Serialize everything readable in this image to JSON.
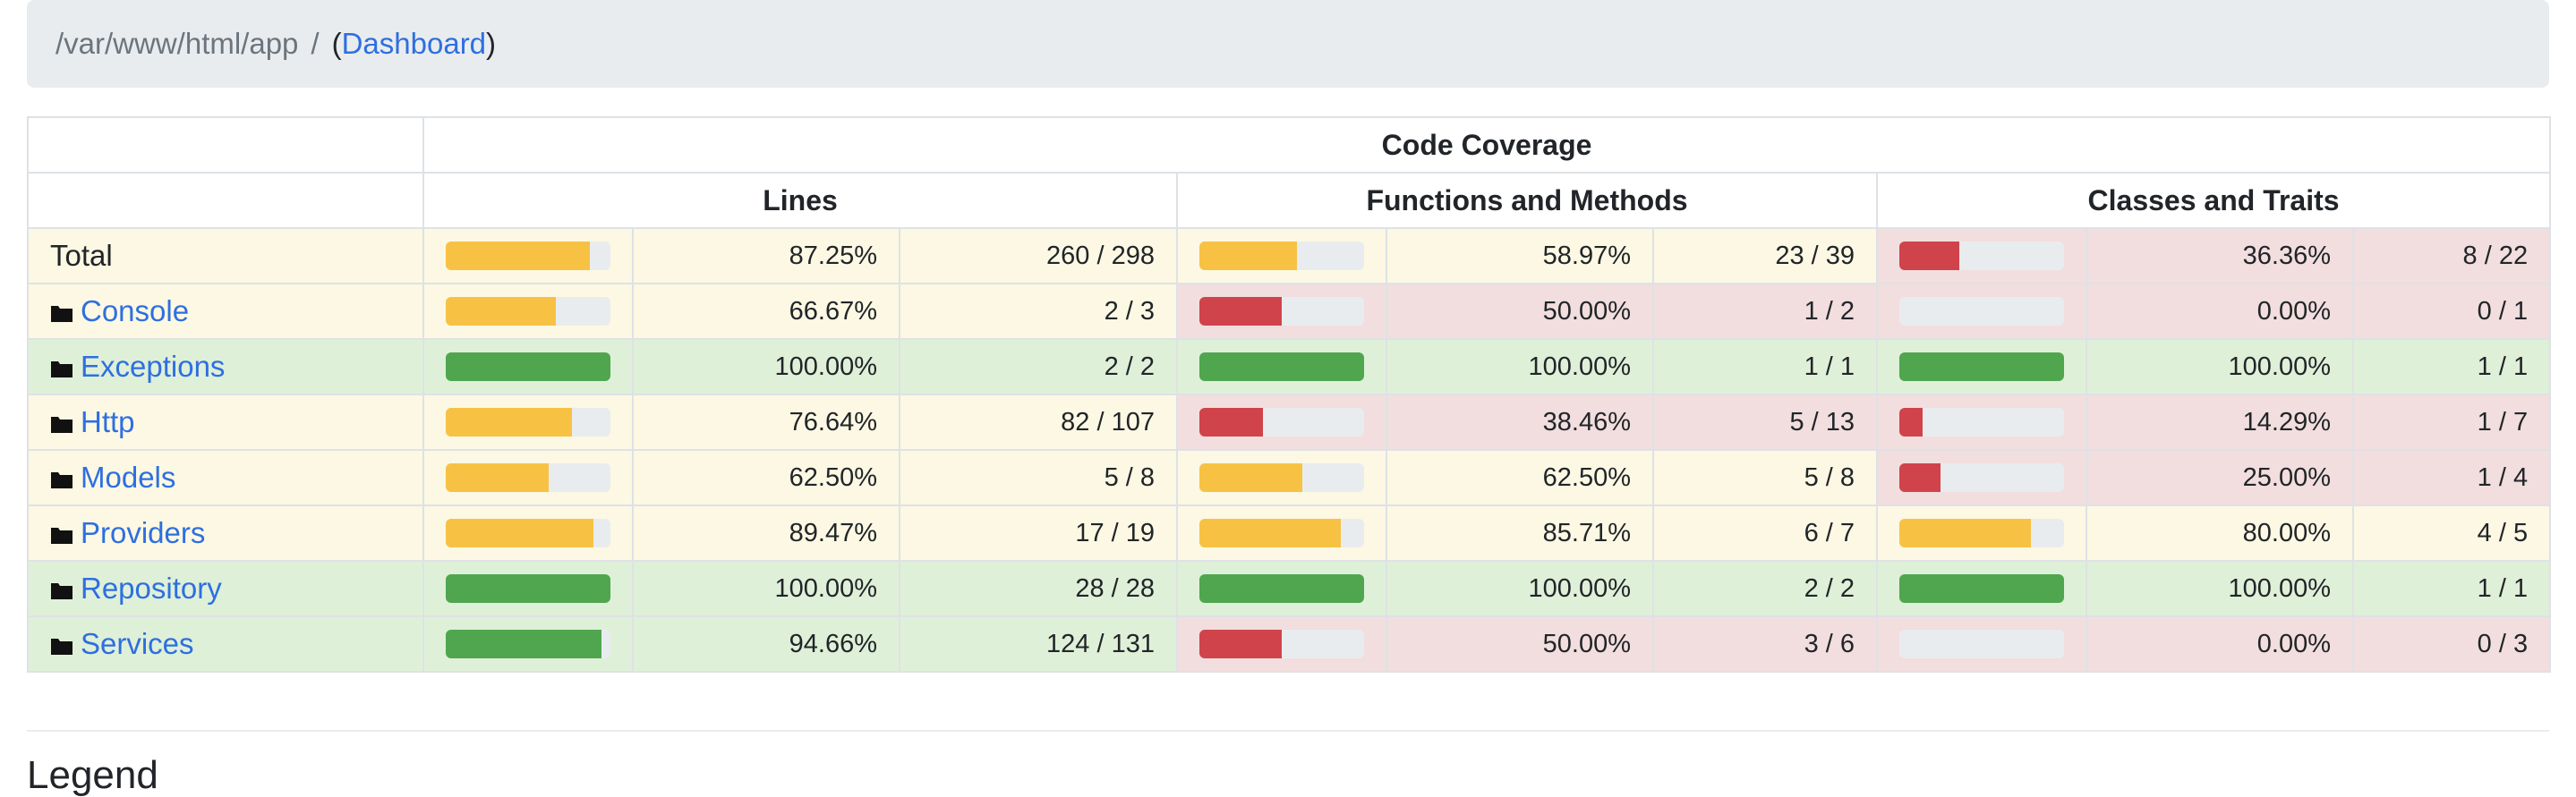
{
  "breadcrumb": {
    "path": "/var/www/html/app",
    "separator": "/",
    "open_paren": "(",
    "link": "Dashboard",
    "close_paren": ")"
  },
  "colors": {
    "high": "#4fa64f",
    "medium": "#f7c244",
    "low": "#d0434a",
    "bar_bg": "#e9ecef"
  },
  "header": {
    "code_coverage": "Code Coverage",
    "lines": "Lines",
    "functions": "Functions and Methods",
    "classes": "Classes and Traits"
  },
  "rows": [
    {
      "name": "Total",
      "folder": false,
      "lines": {
        "pct": "87.25%",
        "ratio": "260 / 298",
        "value": 0.8725,
        "level": "warning"
      },
      "functions": {
        "pct": "58.97%",
        "ratio": "23 / 39",
        "value": 0.5897,
        "level": "warning"
      },
      "classes": {
        "pct": "36.36%",
        "ratio": "8 / 22",
        "value": 0.3636,
        "level": "danger"
      }
    },
    {
      "name": "Console",
      "folder": true,
      "lines": {
        "pct": "66.67%",
        "ratio": "2 / 3",
        "value": 0.6667,
        "level": "warning"
      },
      "functions": {
        "pct": "50.00%",
        "ratio": "1 / 2",
        "value": 0.5,
        "level": "danger"
      },
      "classes": {
        "pct": "0.00%",
        "ratio": "0 / 1",
        "value": 0,
        "level": "danger"
      }
    },
    {
      "name": "Exceptions",
      "folder": true,
      "lines": {
        "pct": "100.00%",
        "ratio": "2 / 2",
        "value": 1,
        "level": "success"
      },
      "functions": {
        "pct": "100.00%",
        "ratio": "1 / 1",
        "value": 1,
        "level": "success"
      },
      "classes": {
        "pct": "100.00%",
        "ratio": "1 / 1",
        "value": 1,
        "level": "success"
      }
    },
    {
      "name": "Http",
      "folder": true,
      "lines": {
        "pct": "76.64%",
        "ratio": "82 / 107",
        "value": 0.7664,
        "level": "warning"
      },
      "functions": {
        "pct": "38.46%",
        "ratio": "5 / 13",
        "value": 0.3846,
        "level": "danger"
      },
      "classes": {
        "pct": "14.29%",
        "ratio": "1 / 7",
        "value": 0.1429,
        "level": "danger"
      }
    },
    {
      "name": "Models",
      "folder": true,
      "lines": {
        "pct": "62.50%",
        "ratio": "5 / 8",
        "value": 0.625,
        "level": "warning"
      },
      "functions": {
        "pct": "62.50%",
        "ratio": "5 / 8",
        "value": 0.625,
        "level": "warning"
      },
      "classes": {
        "pct": "25.00%",
        "ratio": "1 / 4",
        "value": 0.25,
        "level": "danger"
      }
    },
    {
      "name": "Providers",
      "folder": true,
      "lines": {
        "pct": "89.47%",
        "ratio": "17 / 19",
        "value": 0.8947,
        "level": "warning"
      },
      "functions": {
        "pct": "85.71%",
        "ratio": "6 / 7",
        "value": 0.8571,
        "level": "warning"
      },
      "classes": {
        "pct": "80.00%",
        "ratio": "4 / 5",
        "value": 0.8,
        "level": "warning"
      }
    },
    {
      "name": "Repository",
      "folder": true,
      "lines": {
        "pct": "100.00%",
        "ratio": "28 / 28",
        "value": 1,
        "level": "success"
      },
      "functions": {
        "pct": "100.00%",
        "ratio": "2 / 2",
        "value": 1,
        "level": "success"
      },
      "classes": {
        "pct": "100.00%",
        "ratio": "1 / 1",
        "value": 1,
        "level": "success"
      }
    },
    {
      "name": "Services",
      "folder": true,
      "lines": {
        "pct": "94.66%",
        "ratio": "124 / 131",
        "value": 0.9466,
        "level": "success"
      },
      "functions": {
        "pct": "50.00%",
        "ratio": "3 / 6",
        "value": 0.5,
        "level": "danger"
      },
      "classes": {
        "pct": "0.00%",
        "ratio": "0 / 3",
        "value": 0,
        "level": "danger"
      }
    }
  ],
  "legend": {
    "title": "Legend"
  }
}
